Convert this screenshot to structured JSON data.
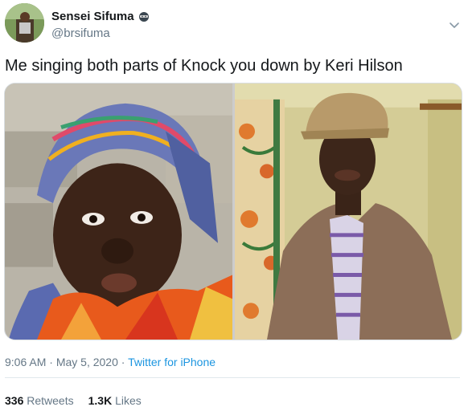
{
  "author": {
    "display_name": "Sensei Sifuma",
    "handle": "@brsifuma",
    "name_emoji": "ninja-emoji"
  },
  "tweet": {
    "text": "Me singing both parts of Knock you down by Keri Hilson"
  },
  "media": {
    "photos": [
      {
        "name": "left-photo",
        "description_icon": "person-headscarf-photo"
      },
      {
        "name": "right-photo",
        "description_icon": "person-cap-photo"
      }
    ]
  },
  "meta": {
    "time": "9:06 AM",
    "separator": " · ",
    "date": "May 5, 2020",
    "source": "Twitter for iPhone"
  },
  "stats": {
    "retweets_count": "336",
    "retweets_label": "Retweets",
    "likes_count": "1.3K",
    "likes_label": "Likes"
  },
  "colors": {
    "text_primary": "#14171a",
    "text_secondary": "#657786",
    "link": "#1b95e0",
    "divider": "#e1e8ed"
  }
}
